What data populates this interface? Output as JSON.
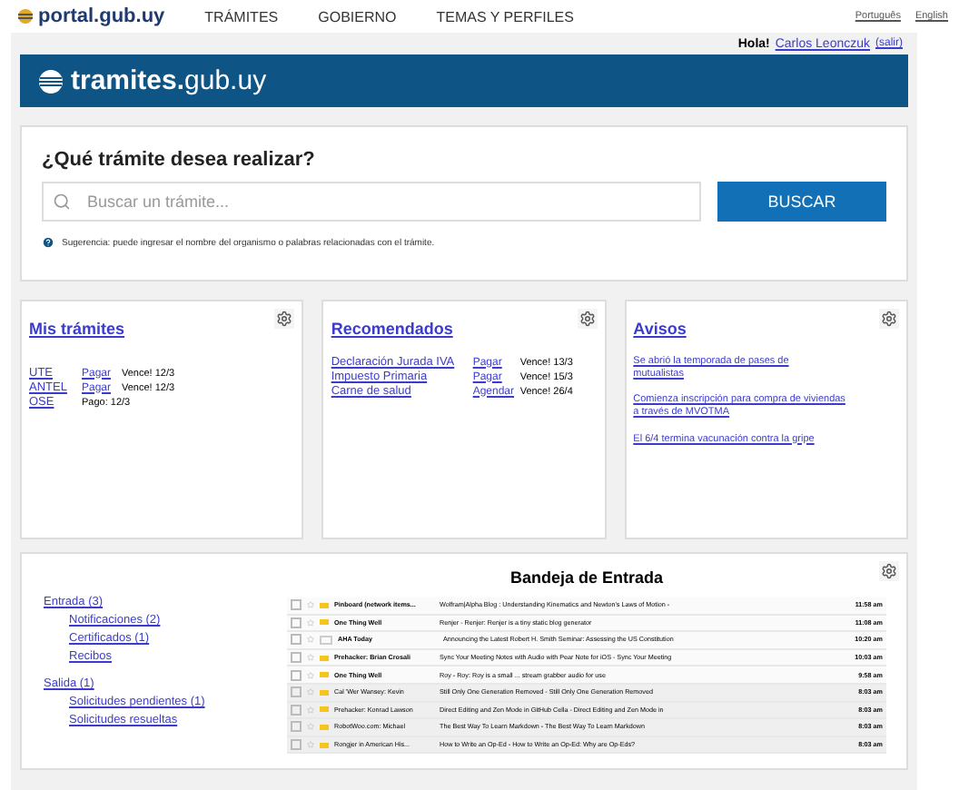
{
  "topnav": {
    "logo": "portal.gub.uy",
    "links": [
      "TRÁMITES",
      "GOBIERNO",
      "TEMAS Y PERFILES"
    ],
    "languages": [
      "Português",
      "English"
    ]
  },
  "user": {
    "greeting": "Hola!",
    "name": "Carlos Leonczuk",
    "logout": "(salir)"
  },
  "banner": {
    "title_bold": "tramites.",
    "title_rest": "gub.uy"
  },
  "search": {
    "heading": "¿Qué trámite desea realizar?",
    "placeholder": "Buscar un trámite...",
    "button": "BUSCAR",
    "hint": "Sugerencia: puede ingresar el nombre del organismo o palabras relacionadas con el trámite."
  },
  "mis_tramites": {
    "title": "Mis trámites",
    "rows": [
      {
        "name": "UTE",
        "action": "Pagar",
        "status": "Vence! 12/3"
      },
      {
        "name": "ANTEL",
        "action": "Pagar",
        "status": "Vence! 12/3"
      },
      {
        "name": "OSE",
        "status": "Pago: 12/3"
      }
    ]
  },
  "recomendados": {
    "title": "Recomendados",
    "rows": [
      {
        "name": "Declaración Jurada IVA",
        "action": "Pagar",
        "status": "Vence! 13/3"
      },
      {
        "name": "Impuesto Primaria",
        "action": "Pagar",
        "status": "Vence! 15/3"
      },
      {
        "name": "Carne de salud",
        "action": "Agendar",
        "status": "Vence! 26/4"
      }
    ]
  },
  "avisos": {
    "title": "Avisos",
    "items": [
      "Se abrió la temporada de pases de mutualistas",
      "Comienza inscripción para compra de viviendas a través de MVOTMA",
      "El 6/4 termina vacunación contra la gripe"
    ]
  },
  "bandeja": {
    "title": "Bandeja de Entrada",
    "folders": [
      {
        "label": "Entrada (3)",
        "children": [
          {
            "label": "Notificaciones (2)"
          },
          {
            "label": "Certificados (1)"
          },
          {
            "label": "Recibos"
          }
        ]
      },
      {
        "label": "Salida (1)",
        "children": [
          {
            "label": "Solicitudes pendientes (1)"
          },
          {
            "label": "Solicitudes resueltas"
          }
        ]
      }
    ],
    "emails": [
      {
        "sender": "Pinboard (network items...",
        "subject": "Wolfram|Alpha Blog : Understanding Kinematics and Newton's Laws of Motion -",
        "time": "11:58 am",
        "important": true,
        "read": false
      },
      {
        "sender": "One Thing Well",
        "subject": "Renjer - Renjer: Renjer is a tiny static blog generator",
        "time": "11:08 am",
        "important": true,
        "read": false
      },
      {
        "sender": "AHA Today",
        "subject": "Announcing the Latest Robert H. Smith Seminar: Assessing the US Constitution",
        "time": "10:20 am",
        "important": false,
        "read": false
      },
      {
        "sender": "Prehacker: Brian Crosali",
        "subject": "Sync Your Meeting Notes with Audio with Pear Note for iOS - Sync Your Meeting",
        "time": "10:03 am",
        "important": true,
        "read": false
      },
      {
        "sender": "One Thing Well",
        "subject": "Roy - Roy: Roy is a small ... stream grabber audio for use",
        "time": "9:58 am",
        "important": true,
        "read": false
      },
      {
        "sender": "Cal 'Wer Wansey: Kevin",
        "subject": "Still Only One Generation Removed - Still Only One Generation Removed",
        "time": "8:03 am",
        "important": true,
        "read": true
      },
      {
        "sender": "Prehacker: Konrad Lawson",
        "subject": "Direct Editing and Zen Mode in GitHub Cella - Direct Editing and Zen Mode in",
        "time": "8:03 am",
        "important": true,
        "read": true
      },
      {
        "sender": "RobotWoo.com: Michael",
        "subject": "The Best Way To Learn Markdown - The Best Way To Learn Markdown",
        "time": "8:03 am",
        "important": true,
        "read": true
      },
      {
        "sender": "Rongjer in American His...",
        "subject": "How to Write an Op-Ed - How to Write an Op-Ed: Why are Op-Eds?",
        "time": "8:03 am",
        "important": true,
        "read": true
      }
    ]
  }
}
